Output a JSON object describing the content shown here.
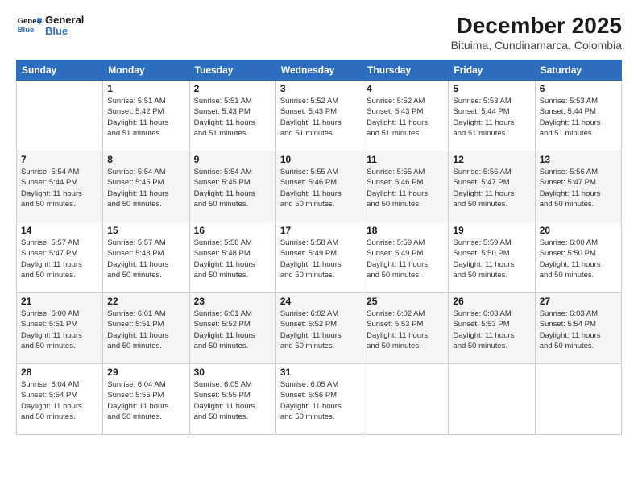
{
  "logo": {
    "line1": "General",
    "line2": "Blue"
  },
  "title": "December 2025",
  "location": "Bituima, Cundinamarca, Colombia",
  "days_of_week": [
    "Sunday",
    "Monday",
    "Tuesday",
    "Wednesday",
    "Thursday",
    "Friday",
    "Saturday"
  ],
  "weeks": [
    [
      {
        "day": "",
        "info": ""
      },
      {
        "day": "1",
        "info": "Sunrise: 5:51 AM\nSunset: 5:42 PM\nDaylight: 11 hours\nand 51 minutes."
      },
      {
        "day": "2",
        "info": "Sunrise: 5:51 AM\nSunset: 5:43 PM\nDaylight: 11 hours\nand 51 minutes."
      },
      {
        "day": "3",
        "info": "Sunrise: 5:52 AM\nSunset: 5:43 PM\nDaylight: 11 hours\nand 51 minutes."
      },
      {
        "day": "4",
        "info": "Sunrise: 5:52 AM\nSunset: 5:43 PM\nDaylight: 11 hours\nand 51 minutes."
      },
      {
        "day": "5",
        "info": "Sunrise: 5:53 AM\nSunset: 5:44 PM\nDaylight: 11 hours\nand 51 minutes."
      },
      {
        "day": "6",
        "info": "Sunrise: 5:53 AM\nSunset: 5:44 PM\nDaylight: 11 hours\nand 51 minutes."
      }
    ],
    [
      {
        "day": "7",
        "info": "Sunrise: 5:54 AM\nSunset: 5:44 PM\nDaylight: 11 hours\nand 50 minutes."
      },
      {
        "day": "8",
        "info": "Sunrise: 5:54 AM\nSunset: 5:45 PM\nDaylight: 11 hours\nand 50 minutes."
      },
      {
        "day": "9",
        "info": "Sunrise: 5:54 AM\nSunset: 5:45 PM\nDaylight: 11 hours\nand 50 minutes."
      },
      {
        "day": "10",
        "info": "Sunrise: 5:55 AM\nSunset: 5:46 PM\nDaylight: 11 hours\nand 50 minutes."
      },
      {
        "day": "11",
        "info": "Sunrise: 5:55 AM\nSunset: 5:46 PM\nDaylight: 11 hours\nand 50 minutes."
      },
      {
        "day": "12",
        "info": "Sunrise: 5:56 AM\nSunset: 5:47 PM\nDaylight: 11 hours\nand 50 minutes."
      },
      {
        "day": "13",
        "info": "Sunrise: 5:56 AM\nSunset: 5:47 PM\nDaylight: 11 hours\nand 50 minutes."
      }
    ],
    [
      {
        "day": "14",
        "info": "Sunrise: 5:57 AM\nSunset: 5:47 PM\nDaylight: 11 hours\nand 50 minutes."
      },
      {
        "day": "15",
        "info": "Sunrise: 5:57 AM\nSunset: 5:48 PM\nDaylight: 11 hours\nand 50 minutes."
      },
      {
        "day": "16",
        "info": "Sunrise: 5:58 AM\nSunset: 5:48 PM\nDaylight: 11 hours\nand 50 minutes."
      },
      {
        "day": "17",
        "info": "Sunrise: 5:58 AM\nSunset: 5:49 PM\nDaylight: 11 hours\nand 50 minutes."
      },
      {
        "day": "18",
        "info": "Sunrise: 5:59 AM\nSunset: 5:49 PM\nDaylight: 11 hours\nand 50 minutes."
      },
      {
        "day": "19",
        "info": "Sunrise: 5:59 AM\nSunset: 5:50 PM\nDaylight: 11 hours\nand 50 minutes."
      },
      {
        "day": "20",
        "info": "Sunrise: 6:00 AM\nSunset: 5:50 PM\nDaylight: 11 hours\nand 50 minutes."
      }
    ],
    [
      {
        "day": "21",
        "info": "Sunrise: 6:00 AM\nSunset: 5:51 PM\nDaylight: 11 hours\nand 50 minutes."
      },
      {
        "day": "22",
        "info": "Sunrise: 6:01 AM\nSunset: 5:51 PM\nDaylight: 11 hours\nand 50 minutes."
      },
      {
        "day": "23",
        "info": "Sunrise: 6:01 AM\nSunset: 5:52 PM\nDaylight: 11 hours\nand 50 minutes."
      },
      {
        "day": "24",
        "info": "Sunrise: 6:02 AM\nSunset: 5:52 PM\nDaylight: 11 hours\nand 50 minutes."
      },
      {
        "day": "25",
        "info": "Sunrise: 6:02 AM\nSunset: 5:53 PM\nDaylight: 11 hours\nand 50 minutes."
      },
      {
        "day": "26",
        "info": "Sunrise: 6:03 AM\nSunset: 5:53 PM\nDaylight: 11 hours\nand 50 minutes."
      },
      {
        "day": "27",
        "info": "Sunrise: 6:03 AM\nSunset: 5:54 PM\nDaylight: 11 hours\nand 50 minutes."
      }
    ],
    [
      {
        "day": "28",
        "info": "Sunrise: 6:04 AM\nSunset: 5:54 PM\nDaylight: 11 hours\nand 50 minutes."
      },
      {
        "day": "29",
        "info": "Sunrise: 6:04 AM\nSunset: 5:55 PM\nDaylight: 11 hours\nand 50 minutes."
      },
      {
        "day": "30",
        "info": "Sunrise: 6:05 AM\nSunset: 5:55 PM\nDaylight: 11 hours\nand 50 minutes."
      },
      {
        "day": "31",
        "info": "Sunrise: 6:05 AM\nSunset: 5:56 PM\nDaylight: 11 hours\nand 50 minutes."
      },
      {
        "day": "",
        "info": ""
      },
      {
        "day": "",
        "info": ""
      },
      {
        "day": "",
        "info": ""
      }
    ]
  ]
}
